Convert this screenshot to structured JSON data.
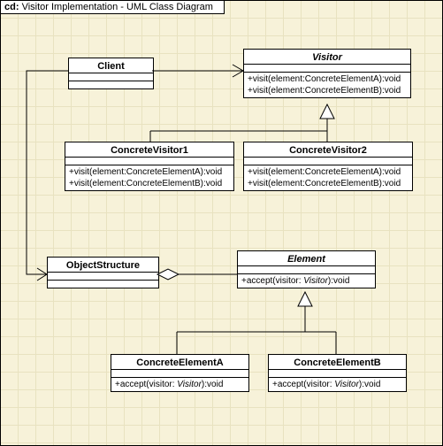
{
  "frame": {
    "kind": "cd:",
    "title": "Visitor Implementation - UML Class Diagram"
  },
  "client": {
    "name": "Client"
  },
  "visitor": {
    "name": "Visitor",
    "op1": "+visit(element:ConcreteElementA):void",
    "op2": "+visit(element:ConcreteElementB):void"
  },
  "cv1": {
    "name": "ConcreteVisitor1",
    "op1": "+visit(element:ConcreteElementA):void",
    "op2": "+visit(element:ConcreteElementB):void"
  },
  "cv2": {
    "name": "ConcreteVisitor2",
    "op1": "+visit(element:ConcreteElementA):void",
    "op2": "+visit(element:ConcreteElementB):void"
  },
  "objstruct": {
    "name": "ObjectStructure"
  },
  "element": {
    "name": "Element",
    "op_pre": "+accept(visitor:",
    "op_vis": " Visitor",
    "op_post": "):void"
  },
  "cea": {
    "name": "ConcreteElementA",
    "op_pre": "+accept(visitor:",
    "op_vis": " Visitor",
    "op_post": "):void"
  },
  "ceb": {
    "name": "ConcreteElementB",
    "op_pre": "+accept(visitor:",
    "op_vis": " Visitor",
    "op_post": "):void"
  }
}
